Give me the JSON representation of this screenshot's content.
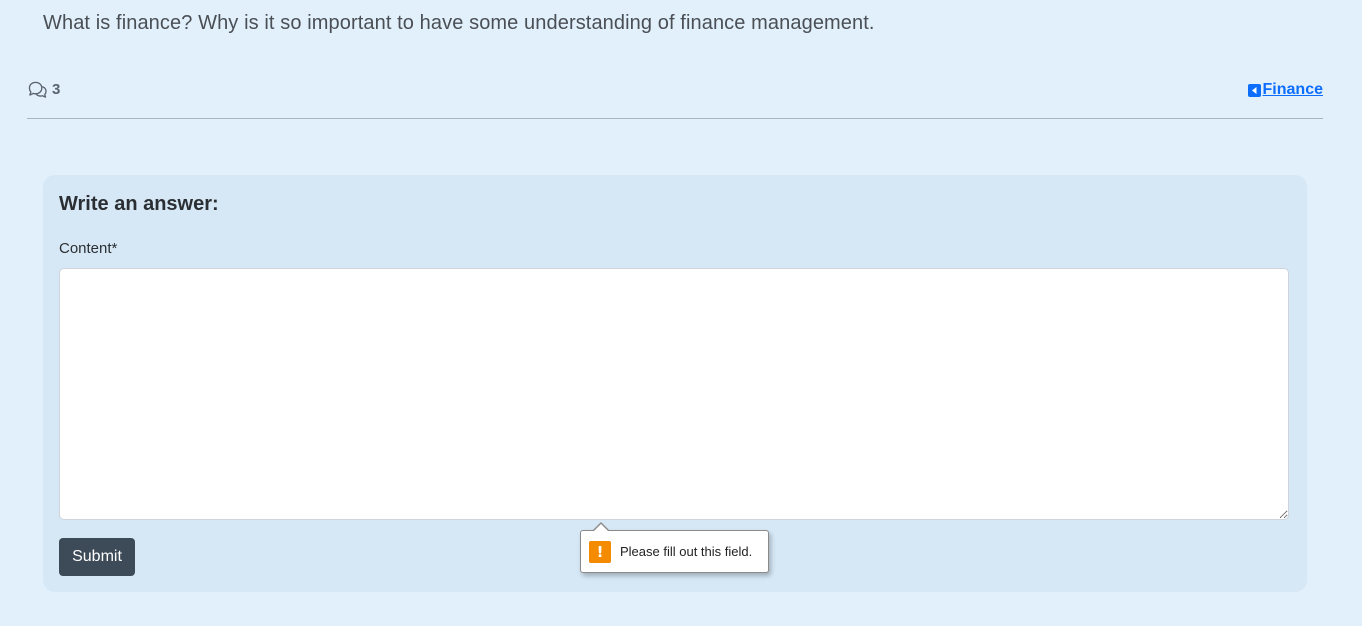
{
  "question": {
    "text": "What is finance? Why is it so important to have some understanding of finance management."
  },
  "meta": {
    "comment_icon": "comments-icon",
    "comment_count": "3",
    "category_icon": "caret-left-square-icon",
    "category_label": "Finance"
  },
  "answer_form": {
    "title": "Write an answer:",
    "content_label": "Content*",
    "content_value": "",
    "submit_label": "Submit"
  },
  "validation_tooltip": {
    "icon": "warning-icon",
    "message": "Please fill out this field."
  },
  "colors": {
    "page_background": "#e2f0fb",
    "card_background": "#d6e8f6",
    "link": "#0d6efd",
    "submit_button": "#3d4a57",
    "warning": "#f48b00"
  }
}
